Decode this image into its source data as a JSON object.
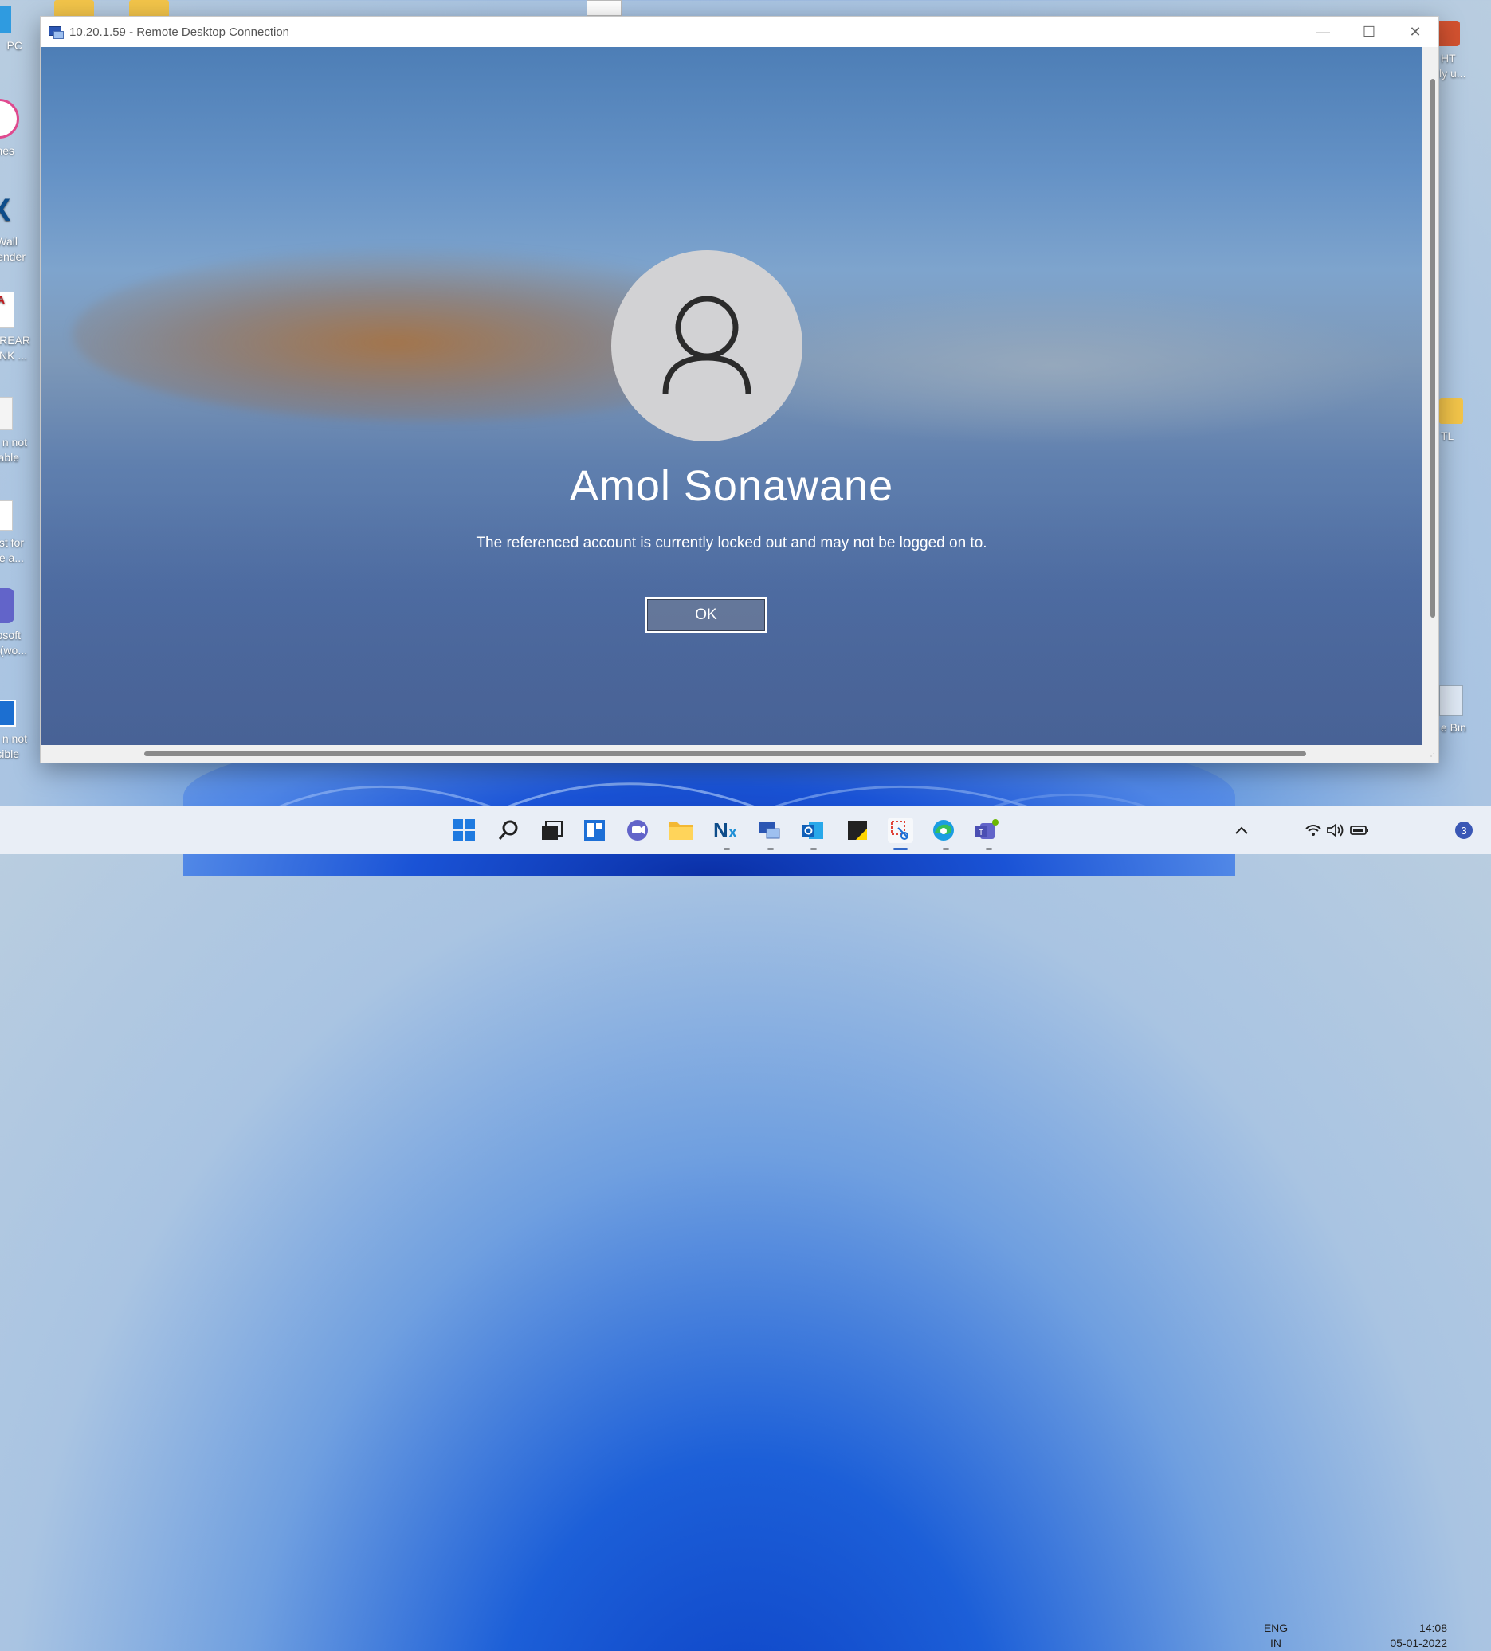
{
  "desktop": {
    "left_icons": [
      {
        "label1": "PC",
        "label2": ""
      },
      {
        "label1": "nes",
        "label2": ""
      },
      {
        "label1": "Wall",
        "label2": "ender"
      },
      {
        "label1": "REAR",
        "label2": "ANK ..."
      },
      {
        "label1": "n not",
        "label2": "able"
      },
      {
        "label1": "st for",
        "label2": "te a..."
      },
      {
        "label1": "osoft",
        "label2": "(wo..."
      },
      {
        "label1": "n not",
        "label2": "sible"
      }
    ],
    "right_icons": [
      {
        "label1": "HT",
        "label2": "ly u..."
      },
      {
        "label1": "TL",
        "label2": ""
      },
      {
        "label1": "e Bin",
        "label2": ""
      }
    ]
  },
  "window": {
    "title": "10.20.1.59 - Remote Desktop Connection",
    "min_glyph": "—",
    "max_glyph": "☐",
    "close_glyph": "✕"
  },
  "login": {
    "user_name": "Amol Sonawane",
    "message": "The referenced account is currently locked out and may not be logged on to.",
    "ok_label": "OK"
  },
  "taskbar": {
    "icons": [
      "start-icon",
      "search-icon",
      "task-view-icon",
      "widgets-icon",
      "chat-icon",
      "file-explorer-icon",
      "nx-icon",
      "remote-desktop-icon",
      "outlook-icon",
      "sticky-notes-icon",
      "snipping-tool-icon",
      "edge-icon",
      "teams-icon"
    ],
    "lang_line1": "ENG",
    "lang_line2": "IN",
    "time": "14:08",
    "date": "05-01-2022",
    "notification_count": "3",
    "accent": "#3268c9"
  }
}
